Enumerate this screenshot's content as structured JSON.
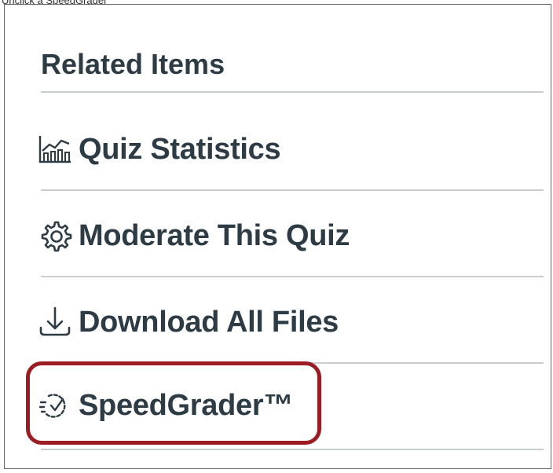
{
  "caption": "Unclick a SpeedGrader",
  "panel": {
    "title": "Related Items",
    "items": [
      {
        "label": "Quiz Statistics",
        "icon": "statistics-chart-icon"
      },
      {
        "label": "Moderate This Quiz",
        "icon": "gear-icon"
      },
      {
        "label": "Download All Files",
        "icon": "download-icon"
      },
      {
        "label": "SpeedGrader™",
        "icon": "speedgrader-icon"
      }
    ]
  },
  "colors": {
    "text": "#2d3b45",
    "divider": "#c7cdd1",
    "highlight": "#9b1c23"
  }
}
